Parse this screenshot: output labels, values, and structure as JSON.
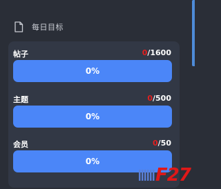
{
  "header": {
    "title": "每日目标",
    "icon": "document-icon"
  },
  "goals": [
    {
      "label": "帖子",
      "current": "0",
      "target": "/1600",
      "progress_text": "0%",
      "progress": 0
    },
    {
      "label": "主题",
      "current": "0",
      "target": "/500",
      "progress_text": "0%",
      "progress": 0
    },
    {
      "label": "会员",
      "current": "0",
      "target": "/50",
      "progress_text": "0%",
      "progress": 0
    }
  ],
  "watermark": {
    "text": "F27"
  },
  "colors": {
    "background": "#2a2e37",
    "panel": "#323845",
    "bar": "#4b86f8",
    "current_count": "#e02020",
    "watermark": "#e01818"
  }
}
